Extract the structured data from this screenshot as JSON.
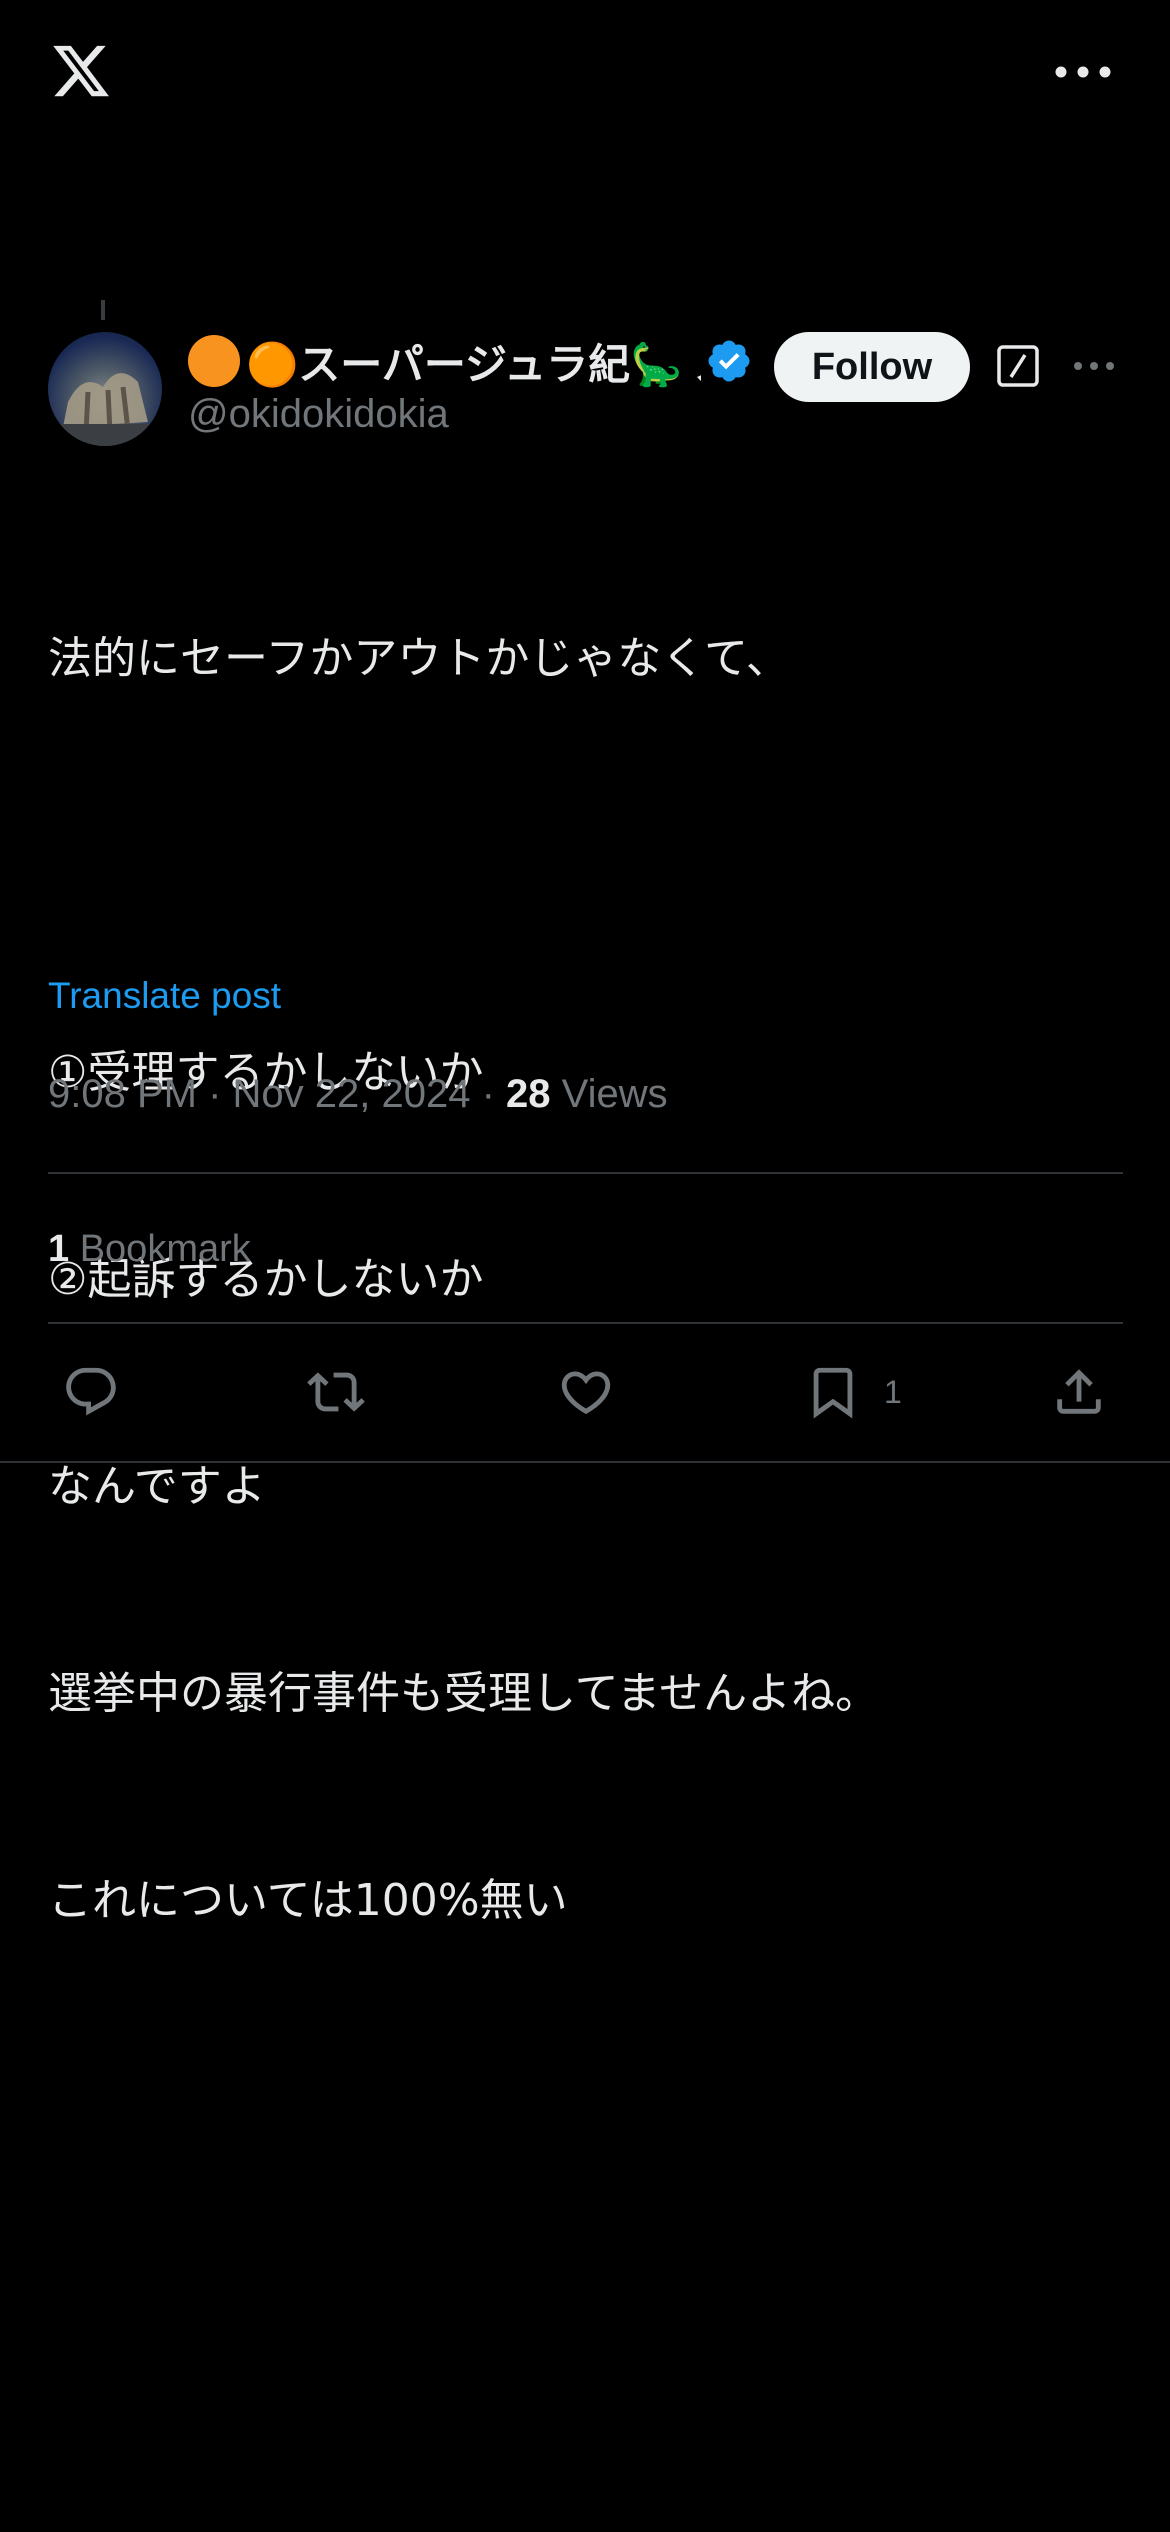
{
  "header": {
    "logo_icon": "x-logo-icon",
    "more_icon": "more-horizontal-icon"
  },
  "post": {
    "author": {
      "display_name": "🟠スーパージュラ紀🦕 ス",
      "handle": "@okidokidokia",
      "verified": true
    },
    "follow_label": "Follow",
    "text_lines": [
      "法的にセーフかアウトかじゃなくて、",
      "",
      "①受理するかしないか",
      "②起訴するかしないか",
      "なんですよ",
      "選挙中の暴行事件も受理してませんよね。",
      "これについては100%無い"
    ],
    "translate_label": "Translate post",
    "time": "9:08 PM",
    "date": "Nov 22, 2024",
    "views_count": "28",
    "views_label": "Views",
    "bookmark_count": "1",
    "bookmark_label": "Bookmark"
  },
  "actions": {
    "bookmark_count": "1"
  },
  "colors": {
    "accent": "#1d9bf0",
    "muted": "#71767b",
    "text": "#e7e9ea",
    "divider": "#2f3336"
  }
}
